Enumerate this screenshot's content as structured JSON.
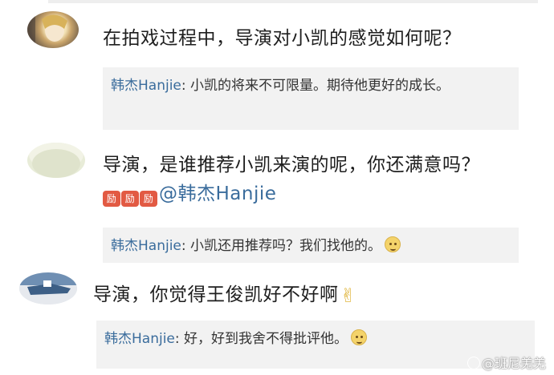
{
  "comments": [
    {
      "avatar_icon": "user-avatar-photo",
      "text": "在拍戏过程中，导演对小凯的感觉如何呢？",
      "reply": {
        "name": "韩杰Hanjie",
        "colon": ":",
        "text": " 小凯的将来不可限量。期待他更好的成长。"
      }
    },
    {
      "avatar_icon": "user-avatar-round",
      "text": "导演，是谁推荐小凯来演的呢，你还满意吗？",
      "stickers": [
        "励",
        "励",
        "励"
      ],
      "mention": "@韩杰Hanjie",
      "reply": {
        "name": "韩杰Hanjie",
        "colon": ":",
        "text": " 小凯还用推荐吗？我们找他的。",
        "emoji": "smile-emoji"
      }
    },
    {
      "avatar_icon": "user-avatar-landscape",
      "text": "导演，你觉得王俊凯好不好啊",
      "emoji": "victory-hand-emoji",
      "reply": {
        "name": "韩杰Hanjie",
        "colon": ":",
        "text": " 好，好到我舍不得批评他。",
        "emoji": "thinking-emoji"
      }
    }
  ],
  "watermark": "@班尼羌羌"
}
